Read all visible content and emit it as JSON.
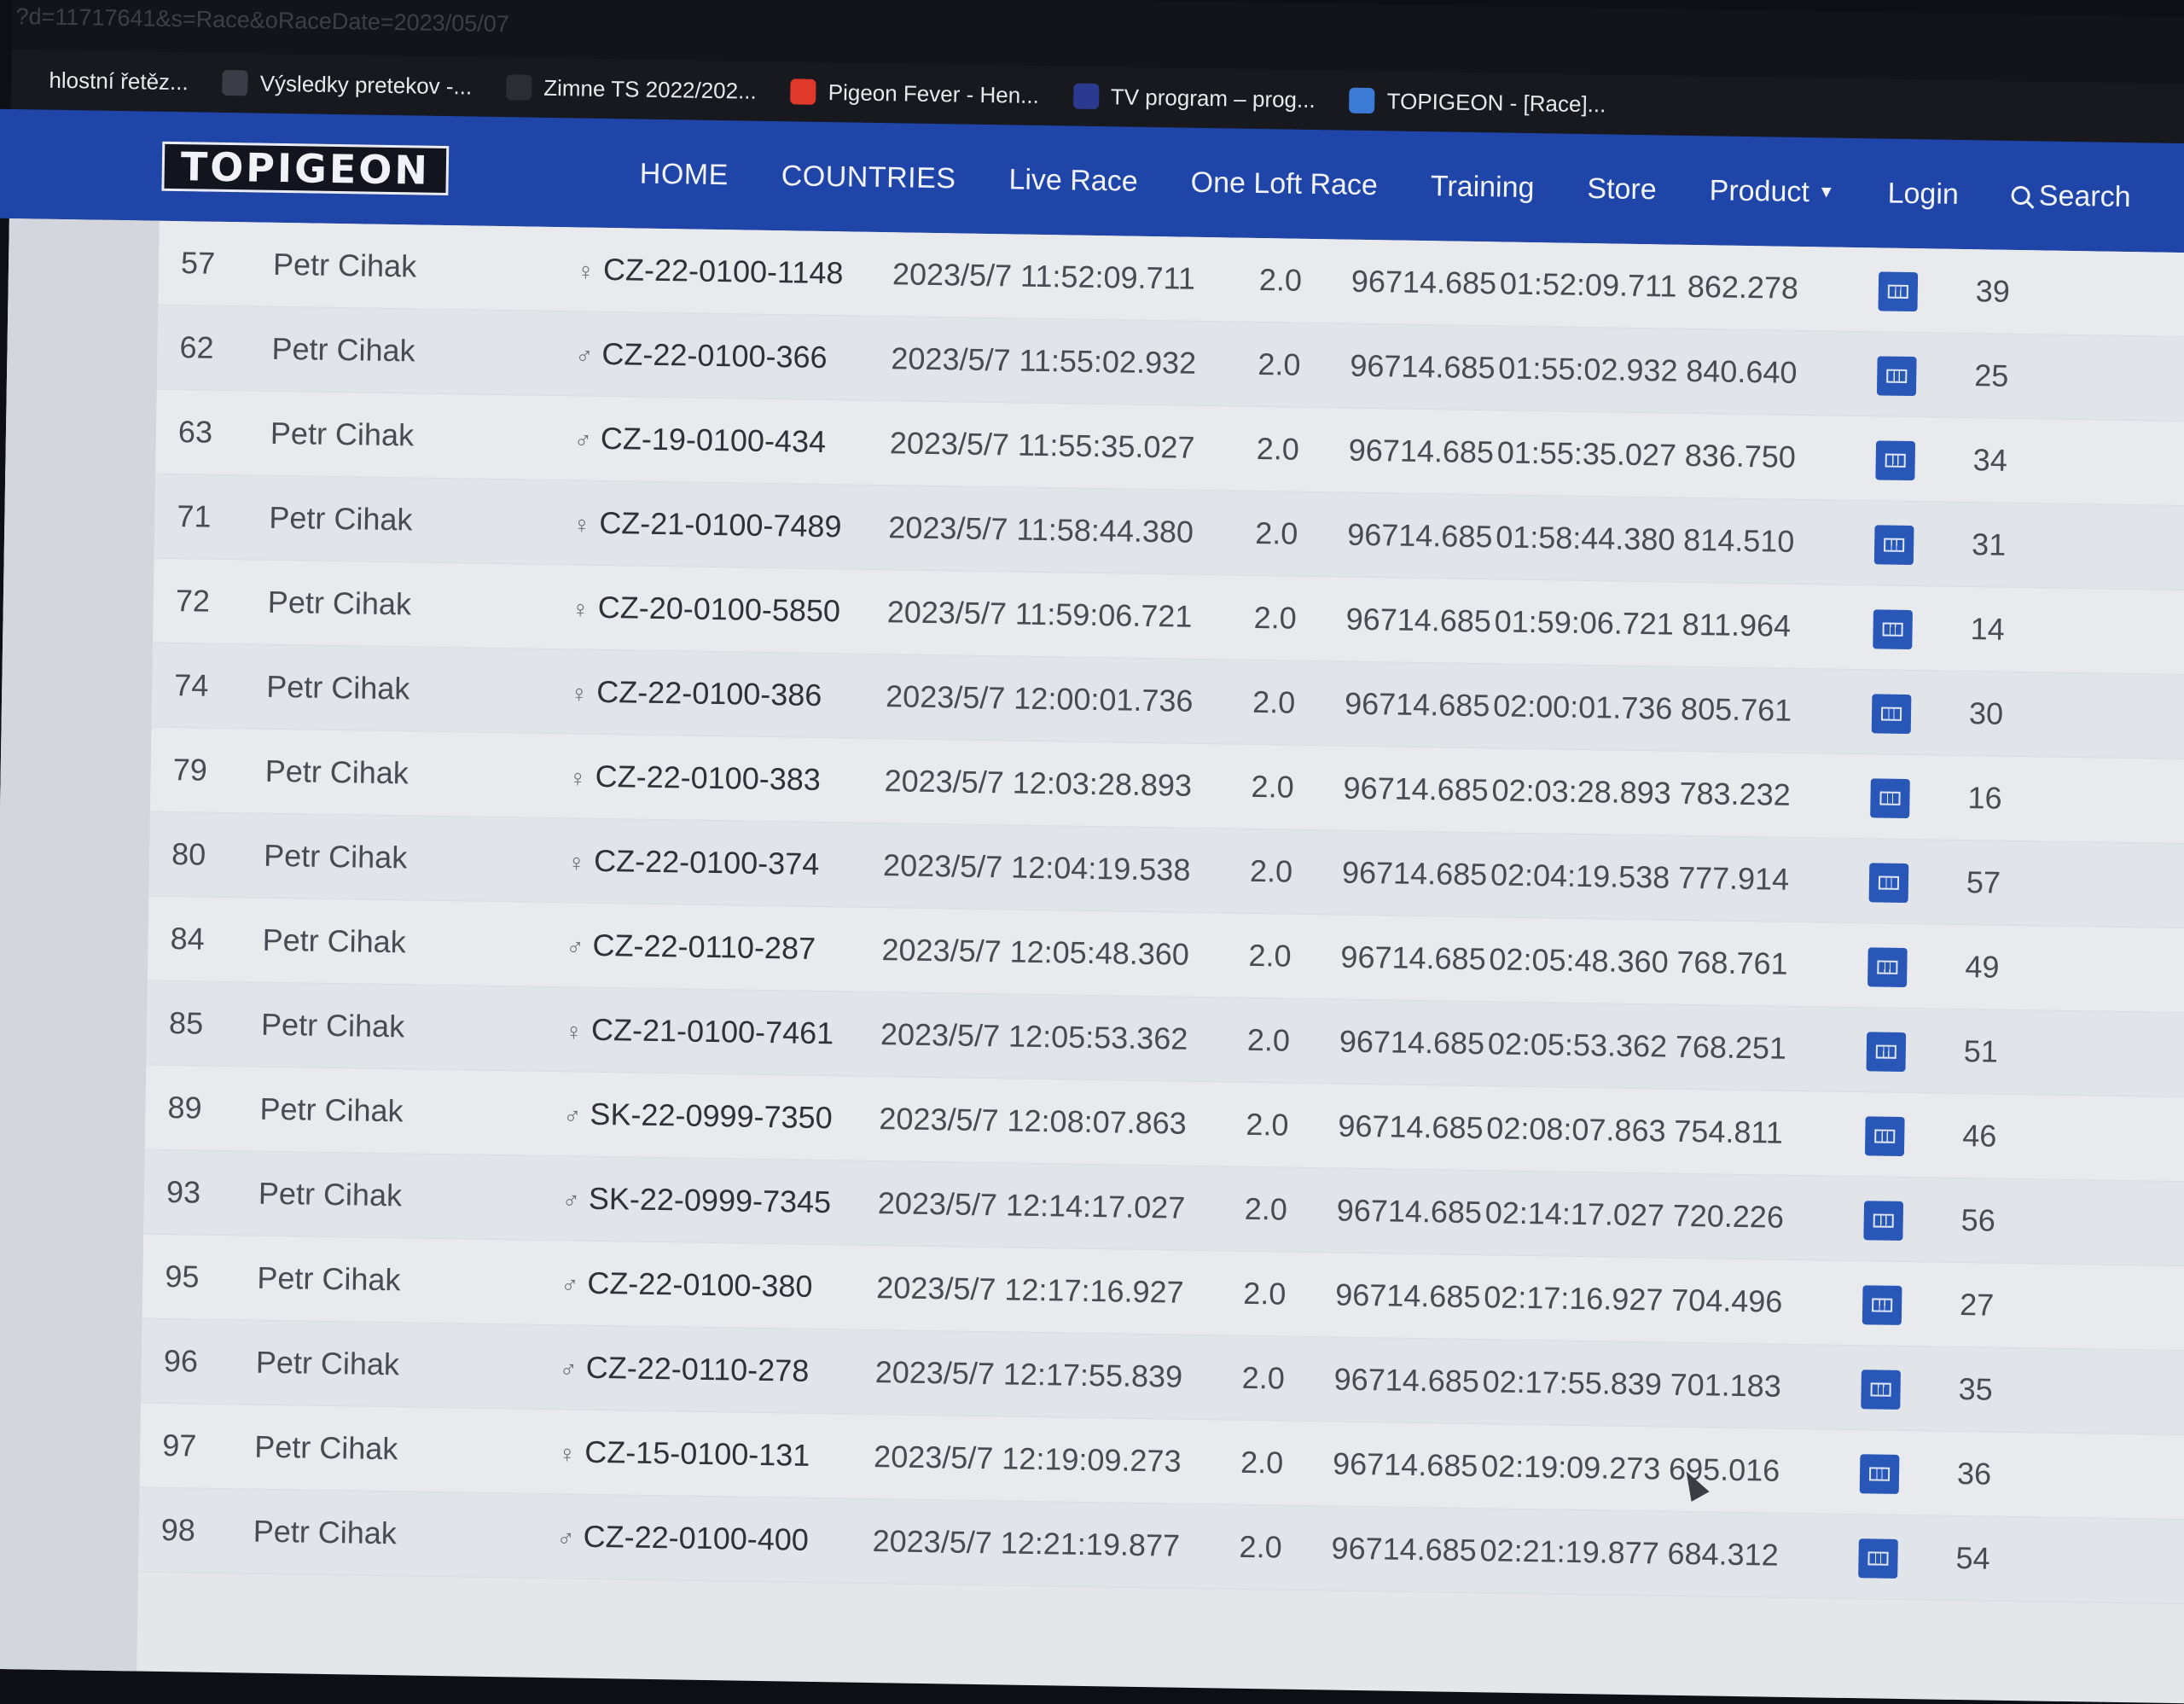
{
  "browser": {
    "url": "?d=11717641&s=Race&oRaceDate=2023/05/07",
    "bookmarks": [
      {
        "label": "hlostní řetěz...",
        "color": "#17191e"
      },
      {
        "label": "Výsledky pretekov -...",
        "color": "#3a3d46"
      },
      {
        "label": "Zimne TS 2022/202...",
        "color": "#2a2d33"
      },
      {
        "label": "Pigeon Fever - Hen...",
        "color": "#e0392b"
      },
      {
        "label": "TV program – prog...",
        "color": "#2b3a8f"
      },
      {
        "label": "TOPIGEON - [Race]...",
        "color": "#3b7bd6"
      }
    ]
  },
  "nav": {
    "logo": "TOPIGEON",
    "items": [
      "HOME",
      "COUNTRIES",
      "Live Race",
      "One Loft Race",
      "Training",
      "Store",
      "Product",
      "Login",
      "Search"
    ],
    "accent": "#1f45a9"
  },
  "results": {
    "rows": [
      {
        "rank": "57",
        "name": "Petr Cihak",
        "sex": "♀",
        "ring": "CZ-22-0100-1148",
        "arrival": "2023/5/7 11:52:09.711",
        "coef": "2.0",
        "distance": "96714.685",
        "flight_time": "01:52:09.711",
        "speed": "862.278",
        "last": "39"
      },
      {
        "rank": "62",
        "name": "Petr Cihak",
        "sex": "♂",
        "ring": "CZ-22-0100-366",
        "arrival": "2023/5/7 11:55:02.932",
        "coef": "2.0",
        "distance": "96714.685",
        "flight_time": "01:55:02.932",
        "speed": "840.640",
        "last": "25"
      },
      {
        "rank": "63",
        "name": "Petr Cihak",
        "sex": "♂",
        "ring": "CZ-19-0100-434",
        "arrival": "2023/5/7 11:55:35.027",
        "coef": "2.0",
        "distance": "96714.685",
        "flight_time": "01:55:35.027",
        "speed": "836.750",
        "last": "34"
      },
      {
        "rank": "71",
        "name": "Petr Cihak",
        "sex": "♀",
        "ring": "CZ-21-0100-7489",
        "arrival": "2023/5/7 11:58:44.380",
        "coef": "2.0",
        "distance": "96714.685",
        "flight_time": "01:58:44.380",
        "speed": "814.510",
        "last": "31"
      },
      {
        "rank": "72",
        "name": "Petr Cihak",
        "sex": "♀",
        "ring": "CZ-20-0100-5850",
        "arrival": "2023/5/7 11:59:06.721",
        "coef": "2.0",
        "distance": "96714.685",
        "flight_time": "01:59:06.721",
        "speed": "811.964",
        "last": "14"
      },
      {
        "rank": "74",
        "name": "Petr Cihak",
        "sex": "♀",
        "ring": "CZ-22-0100-386",
        "arrival": "2023/5/7 12:00:01.736",
        "coef": "2.0",
        "distance": "96714.685",
        "flight_time": "02:00:01.736",
        "speed": "805.761",
        "last": "30"
      },
      {
        "rank": "79",
        "name": "Petr Cihak",
        "sex": "♀",
        "ring": "CZ-22-0100-383",
        "arrival": "2023/5/7 12:03:28.893",
        "coef": "2.0",
        "distance": "96714.685",
        "flight_time": "02:03:28.893",
        "speed": "783.232",
        "last": "16"
      },
      {
        "rank": "80",
        "name": "Petr Cihak",
        "sex": "♀",
        "ring": "CZ-22-0100-374",
        "arrival": "2023/5/7 12:04:19.538",
        "coef": "2.0",
        "distance": "96714.685",
        "flight_time": "02:04:19.538",
        "speed": "777.914",
        "last": "57"
      },
      {
        "rank": "84",
        "name": "Petr Cihak",
        "sex": "♂",
        "ring": "CZ-22-0110-287",
        "arrival": "2023/5/7 12:05:48.360",
        "coef": "2.0",
        "distance": "96714.685",
        "flight_time": "02:05:48.360",
        "speed": "768.761",
        "last": "49"
      },
      {
        "rank": "85",
        "name": "Petr Cihak",
        "sex": "♀",
        "ring": "CZ-21-0100-7461",
        "arrival": "2023/5/7 12:05:53.362",
        "coef": "2.0",
        "distance": "96714.685",
        "flight_time": "02:05:53.362",
        "speed": "768.251",
        "last": "51"
      },
      {
        "rank": "89",
        "name": "Petr Cihak",
        "sex": "♂",
        "ring": "SK-22-0999-7350",
        "arrival": "2023/5/7 12:08:07.863",
        "coef": "2.0",
        "distance": "96714.685",
        "flight_time": "02:08:07.863",
        "speed": "754.811",
        "last": "46"
      },
      {
        "rank": "93",
        "name": "Petr Cihak",
        "sex": "♂",
        "ring": "SK-22-0999-7345",
        "arrival": "2023/5/7 12:14:17.027",
        "coef": "2.0",
        "distance": "96714.685",
        "flight_time": "02:14:17.027",
        "speed": "720.226",
        "last": "56"
      },
      {
        "rank": "95",
        "name": "Petr Cihak",
        "sex": "♂",
        "ring": "CZ-22-0100-380",
        "arrival": "2023/5/7 12:17:16.927",
        "coef": "2.0",
        "distance": "96714.685",
        "flight_time": "02:17:16.927",
        "speed": "704.496",
        "last": "27"
      },
      {
        "rank": "96",
        "name": "Petr Cihak",
        "sex": "♂",
        "ring": "CZ-22-0110-278",
        "arrival": "2023/5/7 12:17:55.839",
        "coef": "2.0",
        "distance": "96714.685",
        "flight_time": "02:17:55.839",
        "speed": "701.183",
        "last": "35"
      },
      {
        "rank": "97",
        "name": "Petr Cihak",
        "sex": "♀",
        "ring": "CZ-15-0100-131",
        "arrival": "2023/5/7 12:19:09.273",
        "coef": "2.0",
        "distance": "96714.685",
        "flight_time": "02:19:09.273",
        "speed": "695.016",
        "last": "36"
      },
      {
        "rank": "98",
        "name": "Petr Cihak",
        "sex": "♂",
        "ring": "CZ-22-0100-400",
        "arrival": "2023/5/7 12:21:19.877",
        "coef": "2.0",
        "distance": "96714.685",
        "flight_time": "02:21:19.877",
        "speed": "684.312",
        "last": "54"
      }
    ]
  }
}
